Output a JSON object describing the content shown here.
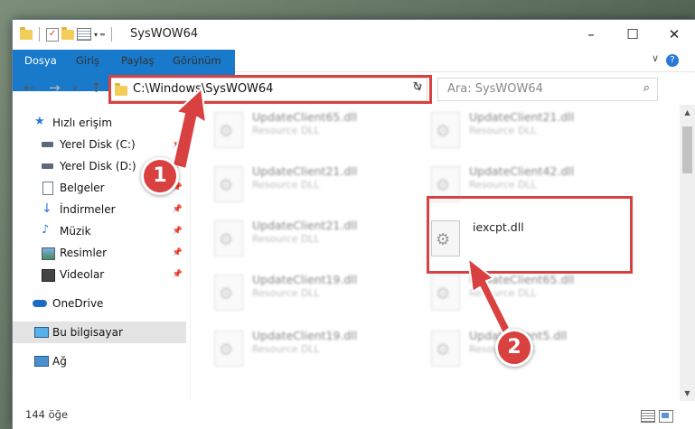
{
  "window": {
    "title": "SysWOW64",
    "minimize": "–",
    "maximize": "☐",
    "close": "✕",
    "qa_dropdown": "▾",
    "qa_more": "═"
  },
  "ribbon": {
    "tabs": [
      "Dosya",
      "Giriş",
      "Paylaş",
      "Görünüm"
    ],
    "help": "?",
    "collapse": "∨"
  },
  "nav": {
    "back": "←",
    "forward": "→",
    "recent": "∨",
    "up": "↑",
    "address": "C:\\Windows\\SysWOW64",
    "address_dropdown": "∨",
    "refresh": "↻",
    "search_placeholder": "Ara: SysWOW64",
    "search_icon": "⌕"
  },
  "sidebar": {
    "items": [
      {
        "label": "Hızlı erişim",
        "icon": "star-icon"
      },
      {
        "label": "Yerel Disk (C:)",
        "icon": "drive-icon",
        "pin": "📌"
      },
      {
        "label": "Yerel Disk (D:)",
        "icon": "drive-icon",
        "pin": "📌"
      },
      {
        "label": "Belgeler",
        "icon": "documents-icon",
        "pin": "📌"
      },
      {
        "label": "İndirmeler",
        "icon": "download-icon",
        "pin": "📌"
      },
      {
        "label": "Müzik",
        "icon": "music-icon",
        "pin": "📌"
      },
      {
        "label": "Resimler",
        "icon": "pictures-icon",
        "pin": "📌"
      },
      {
        "label": "Videolar",
        "icon": "videos-icon",
        "pin": "📌"
      },
      {
        "label": "OneDrive",
        "icon": "cloud-icon"
      },
      {
        "label": "Bu bilgisayar",
        "icon": "computer-icon"
      },
      {
        "label": "Ağ",
        "icon": "network-icon"
      }
    ]
  },
  "files": [
    {
      "name": "UpdateClient65.dll",
      "type": "Resource DLL"
    },
    {
      "name": "UpdateClient21.dll",
      "type": "Resource DLL"
    },
    {
      "name": "UpdateClient21.dll",
      "type": "Resource DLL"
    },
    {
      "name": "UpdateClient42.dll",
      "type": "Resource DLL"
    },
    {
      "name": "UpdateClient21.dll",
      "type": "Resource DLL"
    },
    {
      "name": "iexcpt.dll",
      "type": ""
    },
    {
      "name": "UpdateClient19.dll",
      "type": "Resource DLL"
    },
    {
      "name": "UpdateClient65.dll",
      "type": "Resource DLL"
    },
    {
      "name": "UpdateClient19.dll",
      "type": "Resource DLL"
    },
    {
      "name": "UpdateClient5.dll",
      "type": "Resource DLL"
    }
  ],
  "status": {
    "count": "144 öğe"
  },
  "callouts": [
    "1",
    "2"
  ],
  "colors": {
    "accent": "#1979ca",
    "highlight": "#d94040"
  }
}
